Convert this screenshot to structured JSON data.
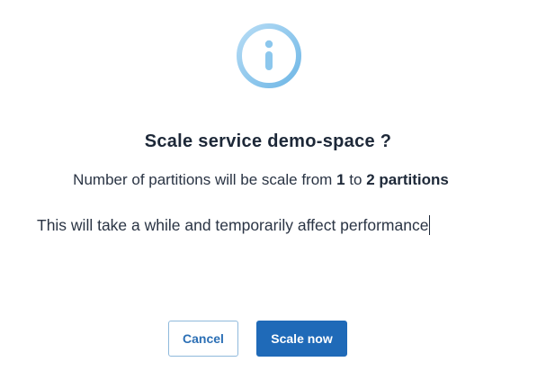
{
  "dialog": {
    "title": "Scale service demo-space ?",
    "line1": {
      "prefix": "Number of partitions will be scale from",
      "from": "1",
      "to_word": "to",
      "to_value": "2 partitions"
    },
    "line2": "This will take a while and temporarily affect performance",
    "icon": "info-circle-icon",
    "icon_colors": [
      "#a8d4f2",
      "#6fb7e6"
    ]
  },
  "buttons": {
    "cancel_label": "Cancel",
    "confirm_label": "Scale now"
  },
  "colors": {
    "primary": "#1f6ab8",
    "text": "#1d2838"
  }
}
